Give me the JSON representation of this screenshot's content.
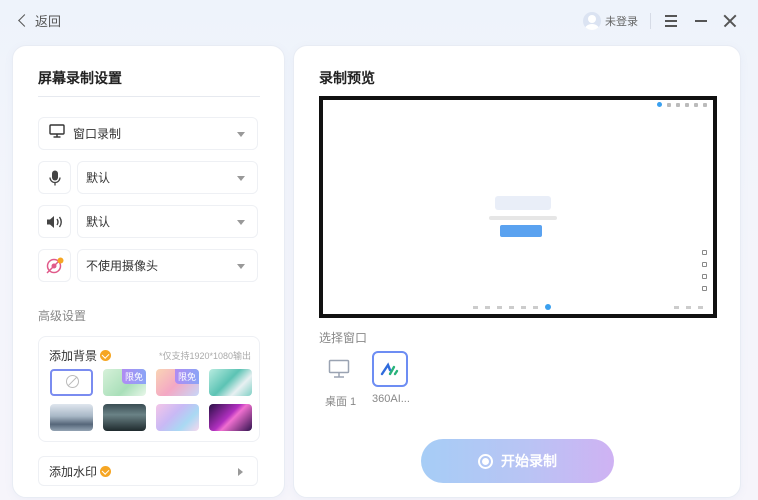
{
  "header": {
    "back_label": "返回",
    "user_label": "未登录"
  },
  "left": {
    "title": "屏幕录制设置",
    "mode": {
      "label": "窗口录制",
      "icon": "monitor-icon"
    },
    "microphone": {
      "label": "默认",
      "icon": "microphone-icon"
    },
    "speaker": {
      "label": "默认",
      "icon": "speaker-icon"
    },
    "camera": {
      "label": "不使用摄像头",
      "icon": "camera-off-icon"
    },
    "advanced_label": "高级设置",
    "background": {
      "title": "添加背景",
      "hint": "*仅支持1920*1080输出",
      "free_tag": "限免",
      "thumbnails": [
        {
          "name": "none",
          "selected": true
        },
        {
          "name": "green-gradient",
          "tag": "限免"
        },
        {
          "name": "peach-gradient",
          "tag": "限免"
        },
        {
          "name": "teal-abstract"
        },
        {
          "name": "mountain-fog"
        },
        {
          "name": "dark-forest"
        },
        {
          "name": "pastel-waves"
        },
        {
          "name": "neon-purple"
        }
      ]
    },
    "watermark": {
      "title": "添加水印"
    }
  },
  "right": {
    "title": "录制预览",
    "choose_label": "选择窗口",
    "windows": [
      {
        "label": "桌面 1",
        "icon": "monitor-icon"
      },
      {
        "label": "360AI...",
        "icon": "app-logo-icon",
        "selected": true
      }
    ],
    "start_label": "开始录制"
  },
  "colors": {
    "accent": "#6d8df3",
    "button_gradient_start": "#a6cdf6",
    "button_gradient_end": "#cfb2f3"
  }
}
